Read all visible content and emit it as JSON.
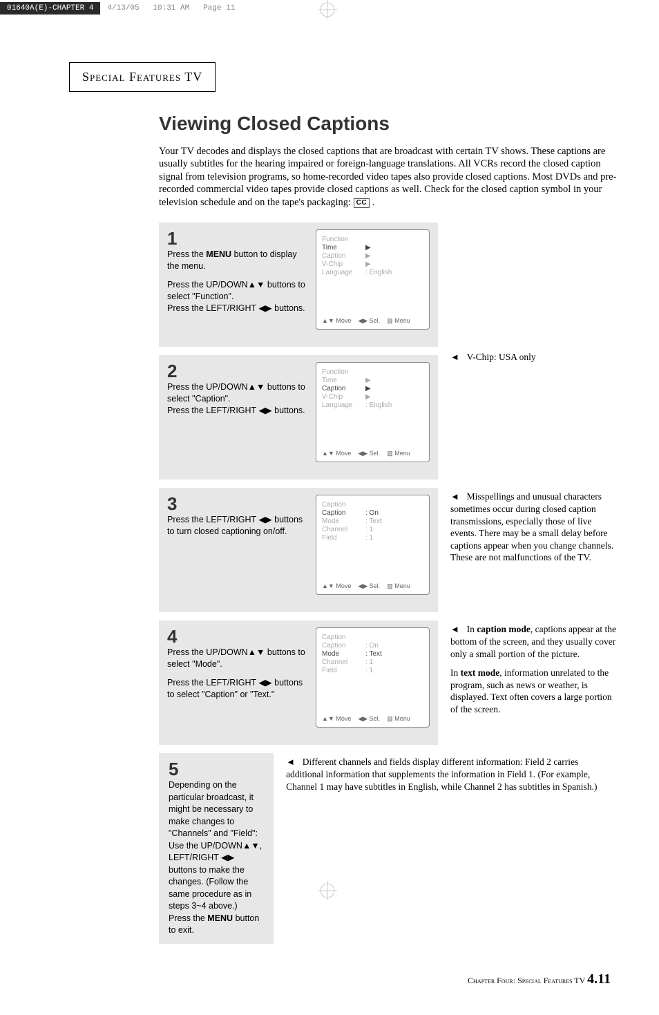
{
  "print_header": {
    "file": "01640A(E)-CHAPTER 4",
    "date": "4/13/05",
    "time": "10:31 AM",
    "page": "Page 11"
  },
  "section_title": "Special Features TV",
  "main_title": "Viewing Closed Captions",
  "intro": "Your TV decodes and displays the closed captions that are broadcast with certain TV shows. These captions are usually subtitles for the hearing impaired or foreign-language translations. All VCRs record the closed caption signal from television programs, so home-recorded video tapes also provide closed captions. Most DVDs and pre-recorded commercial video tapes provide closed captions as well. Check for the closed caption symbol in your television schedule and on the tape's packaging: ",
  "cc_symbol": "CC",
  "steps": [
    {
      "num": "1",
      "text_a": "Press the ",
      "text_b": "MENU",
      "text_c": " button to display the menu.",
      "text_d": "Press the UP/DOWN▲▼ buttons to select \"Function\".",
      "text_e": "Press the LEFT/RIGHT ◀▶ buttons.",
      "osd": {
        "title": "Function",
        "rows": [
          {
            "label": "Time",
            "value": "▶",
            "active": true
          },
          {
            "label": "Caption",
            "value": "▶",
            "active": false
          },
          {
            "label": "V-Chip",
            "value": "▶",
            "active": false
          },
          {
            "label": "Language",
            "value": ": English",
            "active": false
          }
        ]
      },
      "note": ""
    },
    {
      "num": "2",
      "text_a": "Press the UP/DOWN▲▼ buttons to select \"Caption\".",
      "text_b": "Press the LEFT/RIGHT ◀▶ buttons.",
      "osd": {
        "title": "Function",
        "rows": [
          {
            "label": "Time",
            "value": "▶",
            "active": false
          },
          {
            "label": "Caption",
            "value": "▶",
            "active": true
          },
          {
            "label": "V-Chip",
            "value": "▶",
            "active": false
          },
          {
            "label": "Language",
            "value": ": English",
            "active": false
          }
        ]
      },
      "note_lead": "V-Chip: USA only"
    },
    {
      "num": "3",
      "text_a": "Press the LEFT/RIGHT ◀▶ buttons to turn closed captioning on/off.",
      "osd": {
        "title": "Caption",
        "rows": [
          {
            "label": "Caption",
            "value": ": On",
            "active": true
          },
          {
            "label": "Mode",
            "value": ": Text",
            "active": false
          },
          {
            "label": "Channel",
            "value": ": 1",
            "active": false
          },
          {
            "label": "Field",
            "value": ": 1",
            "active": false
          }
        ]
      },
      "note": "Misspellings and unusual characters sometimes occur during closed caption transmissions, especially those of live events. There may be a small delay before captions appear when you change channels. These are not malfunctions of the TV."
    },
    {
      "num": "4",
      "text_a": "Press the UP/DOWN▲▼ buttons to select \"Mode\".",
      "text_b": "Press the LEFT/RIGHT ◀▶ buttons to select \"Caption\" or \"Text.\"",
      "osd": {
        "title": "Caption",
        "rows": [
          {
            "label": "Caption",
            "value": ": On",
            "active": false
          },
          {
            "label": "Mode",
            "value": ": Text",
            "active": true
          },
          {
            "label": "Channel",
            "value": ": 1",
            "active": false
          },
          {
            "label": "Field",
            "value": ": 1",
            "active": false
          }
        ]
      },
      "note_a_bold": "caption mode",
      "note_a": ", captions appear at the bottom of the screen, and they usually cover only a small portion of the picture.",
      "note_a_pre": "In ",
      "note_b_bold": "text mode",
      "note_b_pre": "In ",
      "note_b": ", information unrelated to the program, such as news or weather, is displayed. Text often covers a large portion of the screen."
    }
  ],
  "step5": {
    "num": "5",
    "line1": "Depending on the particular broadcast, it might be necessary to make changes to \"Channels\" and \"Field\":",
    "line2_a": "Use the UP/DOWN▲▼, LEFT/RIGHT ◀▶ buttons to make the changes. (Follow the same procedure as in steps 3~4 above.)",
    "line3_a": "Press the ",
    "line3_b": "MENU",
    "line3_c": " button to exit."
  },
  "step5_note": "Different channels and fields display different information: Field 2 carries additional information that supplements the information in Field 1. (For example, Channel 1 may have subtitles in English, while Channel 2 has subtitles in Spanish.)",
  "osd_hints": {
    "move": "▲▼ Move",
    "sel": "◀▶ Sel.",
    "menu": "▥ Menu"
  },
  "footer": {
    "chapter": "Chapter Four: Special Features TV",
    "page": "4.11"
  }
}
